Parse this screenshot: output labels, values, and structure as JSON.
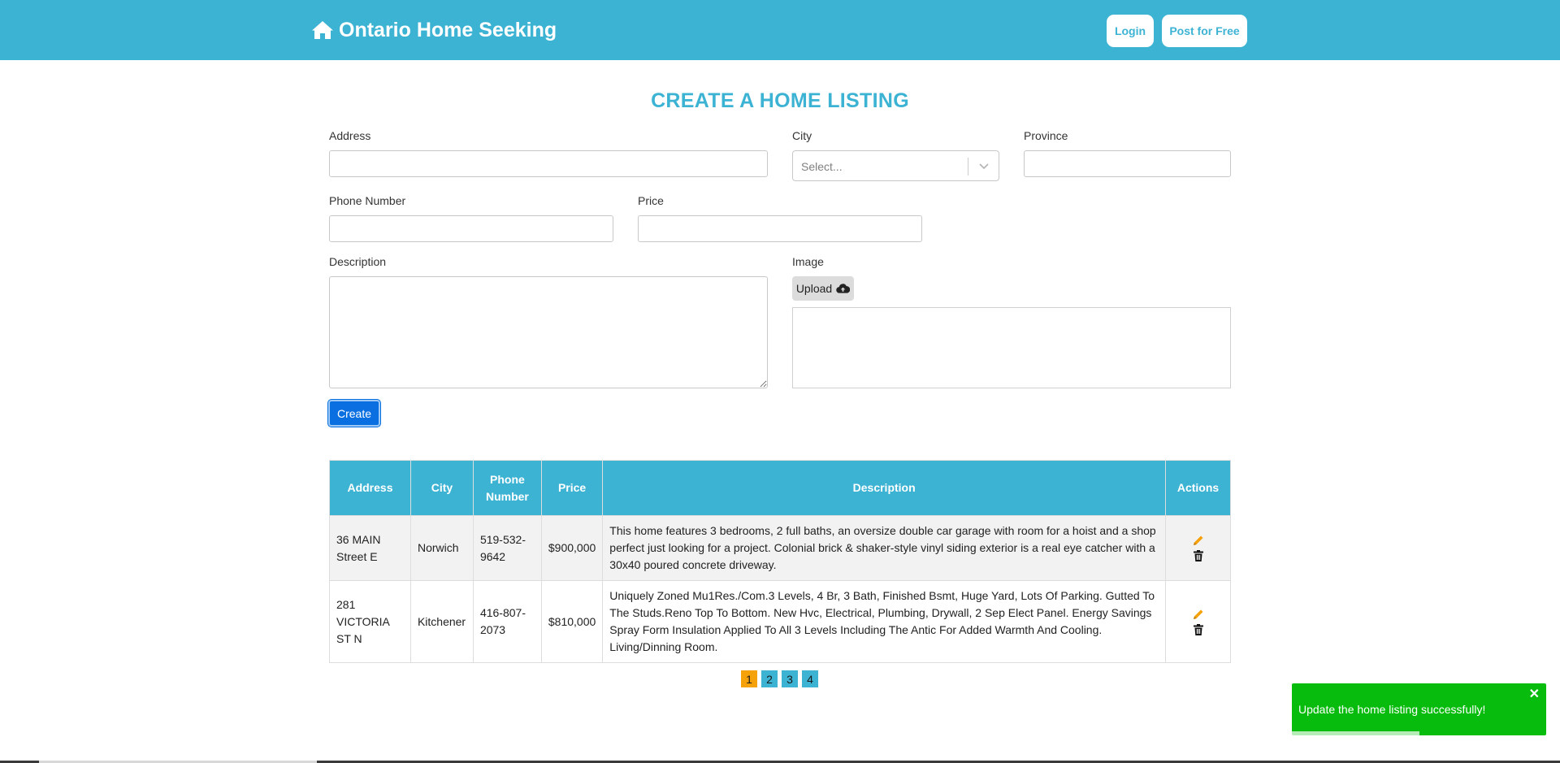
{
  "header": {
    "brand": "Ontario Home Seeking",
    "brand_icon": "home-icon",
    "login_label": "Login",
    "post_label": "Post for Free",
    "bg_color": "#3db3d4"
  },
  "form": {
    "title": "CREATE A HOME LISTING",
    "address_label": "Address",
    "city_label": "City",
    "city_placeholder": "Select...",
    "province_label": "Province",
    "phone_label": "Phone Number",
    "price_label": "Price",
    "description_label": "Description",
    "image_label": "Image",
    "upload_label": "Upload",
    "upload_icon": "cloud-upload-icon",
    "create_label": "Create",
    "address_value": "",
    "province_value": "",
    "phone_value": "",
    "price_value": "",
    "description_value": ""
  },
  "table": {
    "headers": [
      "Address",
      "City",
      "Phone Number",
      "Price",
      "Description",
      "Actions"
    ],
    "rows": [
      {
        "address": "36 MAIN Street E",
        "city": "Norwich",
        "phone": "519-532-9642",
        "price": "$900,000",
        "description": "This home features 3 bedrooms, 2 full baths, an oversize double car garage with room for a hoist and a shop perfect just looking for a project. Colonial brick & shaker-style vinyl siding exterior is a real eye catcher with a 30x40 poured concrete driveway."
      },
      {
        "address": "281 VICTORIA ST N",
        "city": "Kitchener",
        "phone": "416-807-2073",
        "price": "$810,000",
        "description": "Uniquely Zoned Mu1Res./Com.3 Levels, 4 Br, 3 Bath, Finished Bsmt, Huge Yard, Lots Of Parking. Gutted To The Studs.Reno Top To Bottom. New Hvc, Electrical, Plumbing, Drywall, 2 Sep Elect Panel. Energy Savings Spray Form Insulation Applied To All 3 Levels Including The Antic For Added Warmth And Cooling. Living/Dinning Room."
      }
    ],
    "edit_icon": "pencil-icon",
    "delete_icon": "trash-icon"
  },
  "pagination": {
    "pages": [
      "1",
      "2",
      "3",
      "4"
    ],
    "active": "1"
  },
  "toast": {
    "message": "Update the home listing successfully!",
    "close": "✕",
    "progress": 0.5,
    "color": "#07bc0c"
  }
}
